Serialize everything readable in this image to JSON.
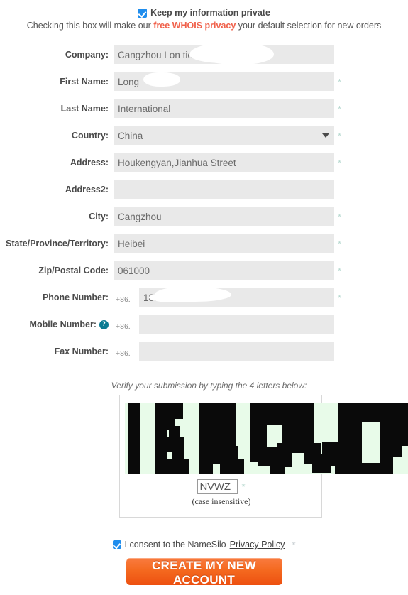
{
  "privacy": {
    "checkbox_checked": true,
    "checkbox_label": "Keep my information private",
    "desc_before": "Checking this box will make our",
    "desc_link": "free WHOIS privacy",
    "desc_after": "your default selection for new orders",
    "link_color": "#f0614b"
  },
  "form": {
    "fields": [
      {
        "label": "Company:",
        "value": "Cangzhou Lon        tional trade co.,",
        "required": false,
        "type": "text",
        "redacted": true
      },
      {
        "label": "First Name:",
        "value": "Long",
        "required": true,
        "type": "text",
        "redacted": true
      },
      {
        "label": "Last Name:",
        "value": "International",
        "required": true,
        "type": "text",
        "redacted": false
      },
      {
        "label": "Country:",
        "value": "China",
        "required": true,
        "type": "select",
        "redacted": false
      },
      {
        "label": "Address:",
        "value": "Houkengyan,Jianhua Street",
        "required": true,
        "type": "text",
        "redacted": false
      },
      {
        "label": "Address2:",
        "value": "",
        "required": false,
        "type": "text",
        "redacted": false
      },
      {
        "label": "City:",
        "value": "Cangzhou",
        "required": true,
        "type": "text",
        "redacted": false
      },
      {
        "label": "State/Province/Territory:",
        "value": "Heibei",
        "required": true,
        "type": "text",
        "redacted": false
      },
      {
        "label": "Zip/Postal Code:",
        "value": "061000",
        "required": true,
        "type": "text",
        "redacted": false
      },
      {
        "label": "Phone Number:",
        "value": "1887",
        "required": true,
        "type": "phone",
        "country_code": "+86.",
        "redacted": true
      },
      {
        "label": "Mobile Number:",
        "value": "",
        "required": false,
        "type": "phone",
        "country_code": "+86.",
        "help": true
      },
      {
        "label": "Fax Number:",
        "value": "",
        "required": false,
        "type": "phone",
        "country_code": "+86."
      }
    ],
    "required_marker": "*",
    "country_selected": "China",
    "country_options": [
      "China"
    ]
  },
  "captcha": {
    "hint": "Verify your submission by typing the 4 letters below:",
    "letters": "NVWZ",
    "input_value": "NVWZ",
    "required_marker": "*",
    "note": "(case insensitive)",
    "bg_color": "#e8fbe9",
    "ink_color": "#0a0a0a"
  },
  "consent": {
    "checked": true,
    "text_before": "I consent to the NameSilo",
    "link": "Privacy Policy",
    "required_marker": "*"
  },
  "submit": {
    "label": "CREATE MY NEW ACCOUNT",
    "color": "#f4691f"
  }
}
